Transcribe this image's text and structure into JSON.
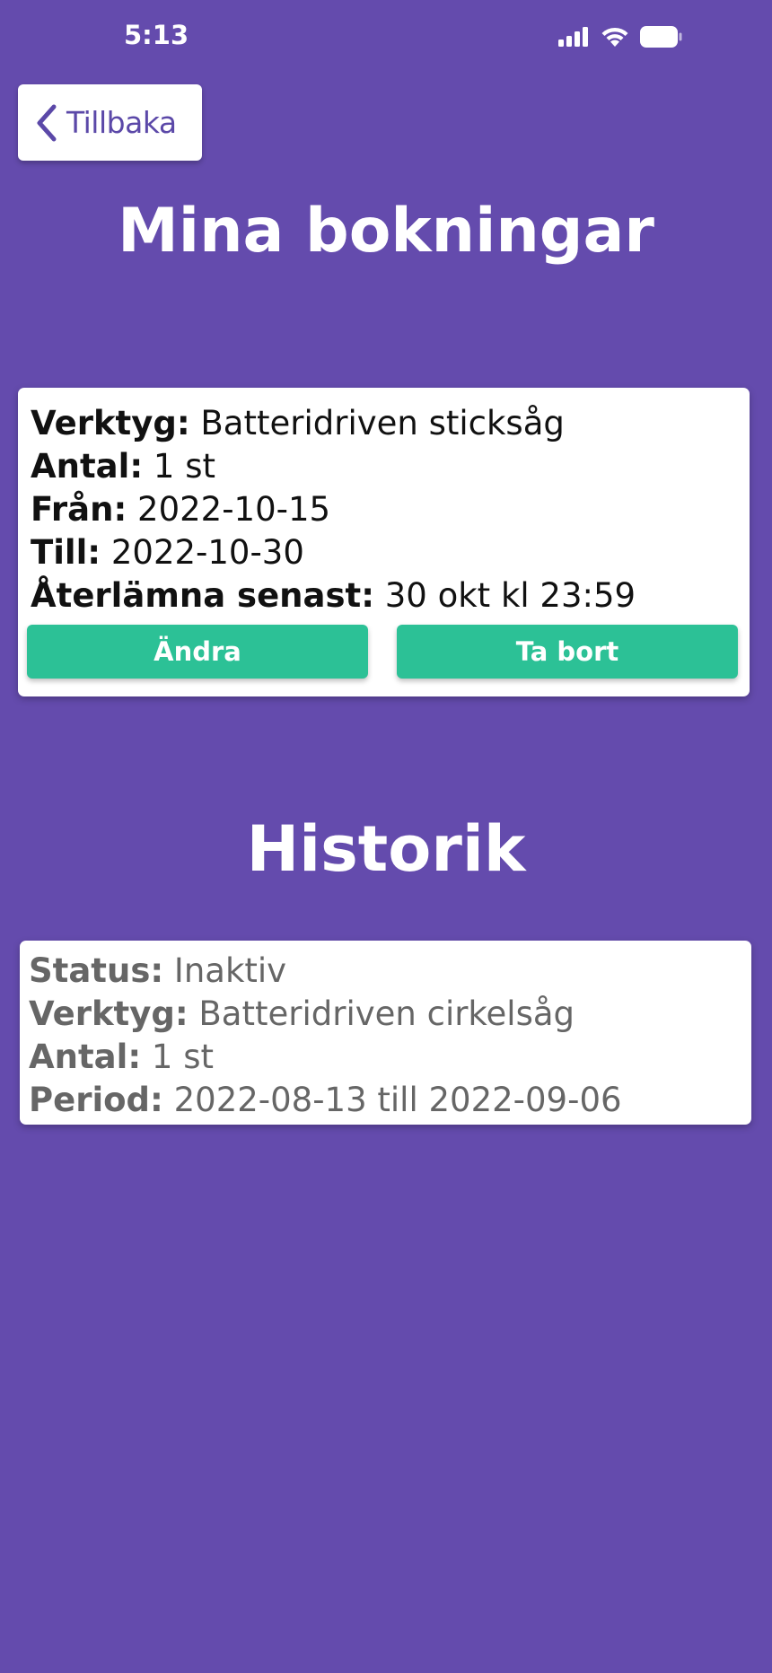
{
  "status_bar": {
    "time": "5:13"
  },
  "header": {
    "back_label": "Tillbaka",
    "title": "Mina bokningar"
  },
  "booking": {
    "tool_label": "Verktyg:",
    "tool_value": "Batteridriven sticksåg",
    "quantity_label": "Antal:",
    "quantity_value": "1 st",
    "from_label": "Från:",
    "from_value": "2022-10-15",
    "to_label": "Till:",
    "to_value": "2022-10-30",
    "return_label": "Återlämna senast:",
    "return_value": "30 okt kl 23:59",
    "edit_label": "Ändra",
    "delete_label": "Ta bort"
  },
  "history": {
    "title": "Historik",
    "items": [
      {
        "status_label": "Status:",
        "status_value": "Inaktiv",
        "tool_label": "Verktyg:",
        "tool_value": "Batteridriven cirkelsåg",
        "quantity_label": "Antal:",
        "quantity_value": "1 st",
        "period_label": "Period:",
        "period_value": "2022-08-13 till 2022-09-06"
      }
    ]
  },
  "colors": {
    "background": "#644bad",
    "accent": "#2cc196",
    "back_text": "#5b48a8"
  },
  "icons": [
    "signal-icon",
    "wifi-icon",
    "battery-icon",
    "chevron-left-icon"
  ]
}
